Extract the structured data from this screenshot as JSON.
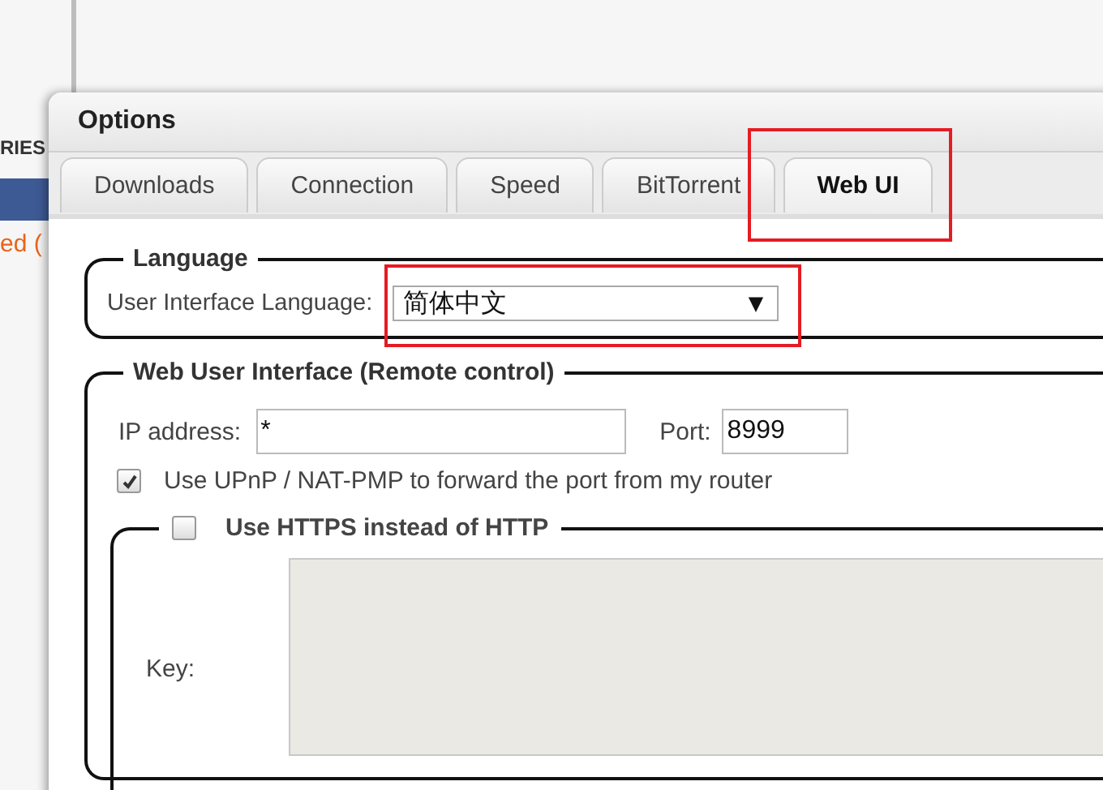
{
  "sidebar": {
    "heading": "RIES",
    "items": [
      {
        "selected": true
      },
      {
        "label": "ed (",
        "selected": false
      }
    ]
  },
  "dialog": {
    "title": "Options",
    "tabs": [
      {
        "label": "Downloads",
        "selected": false,
        "highlighted": false
      },
      {
        "label": "Connection",
        "selected": false,
        "highlighted": false
      },
      {
        "label": "Speed",
        "selected": false,
        "highlighted": false
      },
      {
        "label": "BitTorrent",
        "selected": false,
        "highlighted": false
      },
      {
        "label": "Web UI",
        "selected": true,
        "highlighted": true
      }
    ],
    "language": {
      "legend": "Language",
      "label": "User Interface Language:",
      "value": "简体中文",
      "arrow": "▼",
      "highlighted": true
    },
    "web_ui": {
      "legend": "Web User Interface (Remote control)",
      "ip": {
        "label": "IP address:",
        "value": "*"
      },
      "port": {
        "label": "Port:",
        "value": "8999"
      },
      "upnp": {
        "label": "Use UPnP / NAT-PMP to forward the port from my router",
        "checked": true
      },
      "https": {
        "label": "Use HTTPS instead of HTTP",
        "checked": false
      },
      "key": {
        "label": "Key:",
        "disabled": true
      }
    }
  }
}
